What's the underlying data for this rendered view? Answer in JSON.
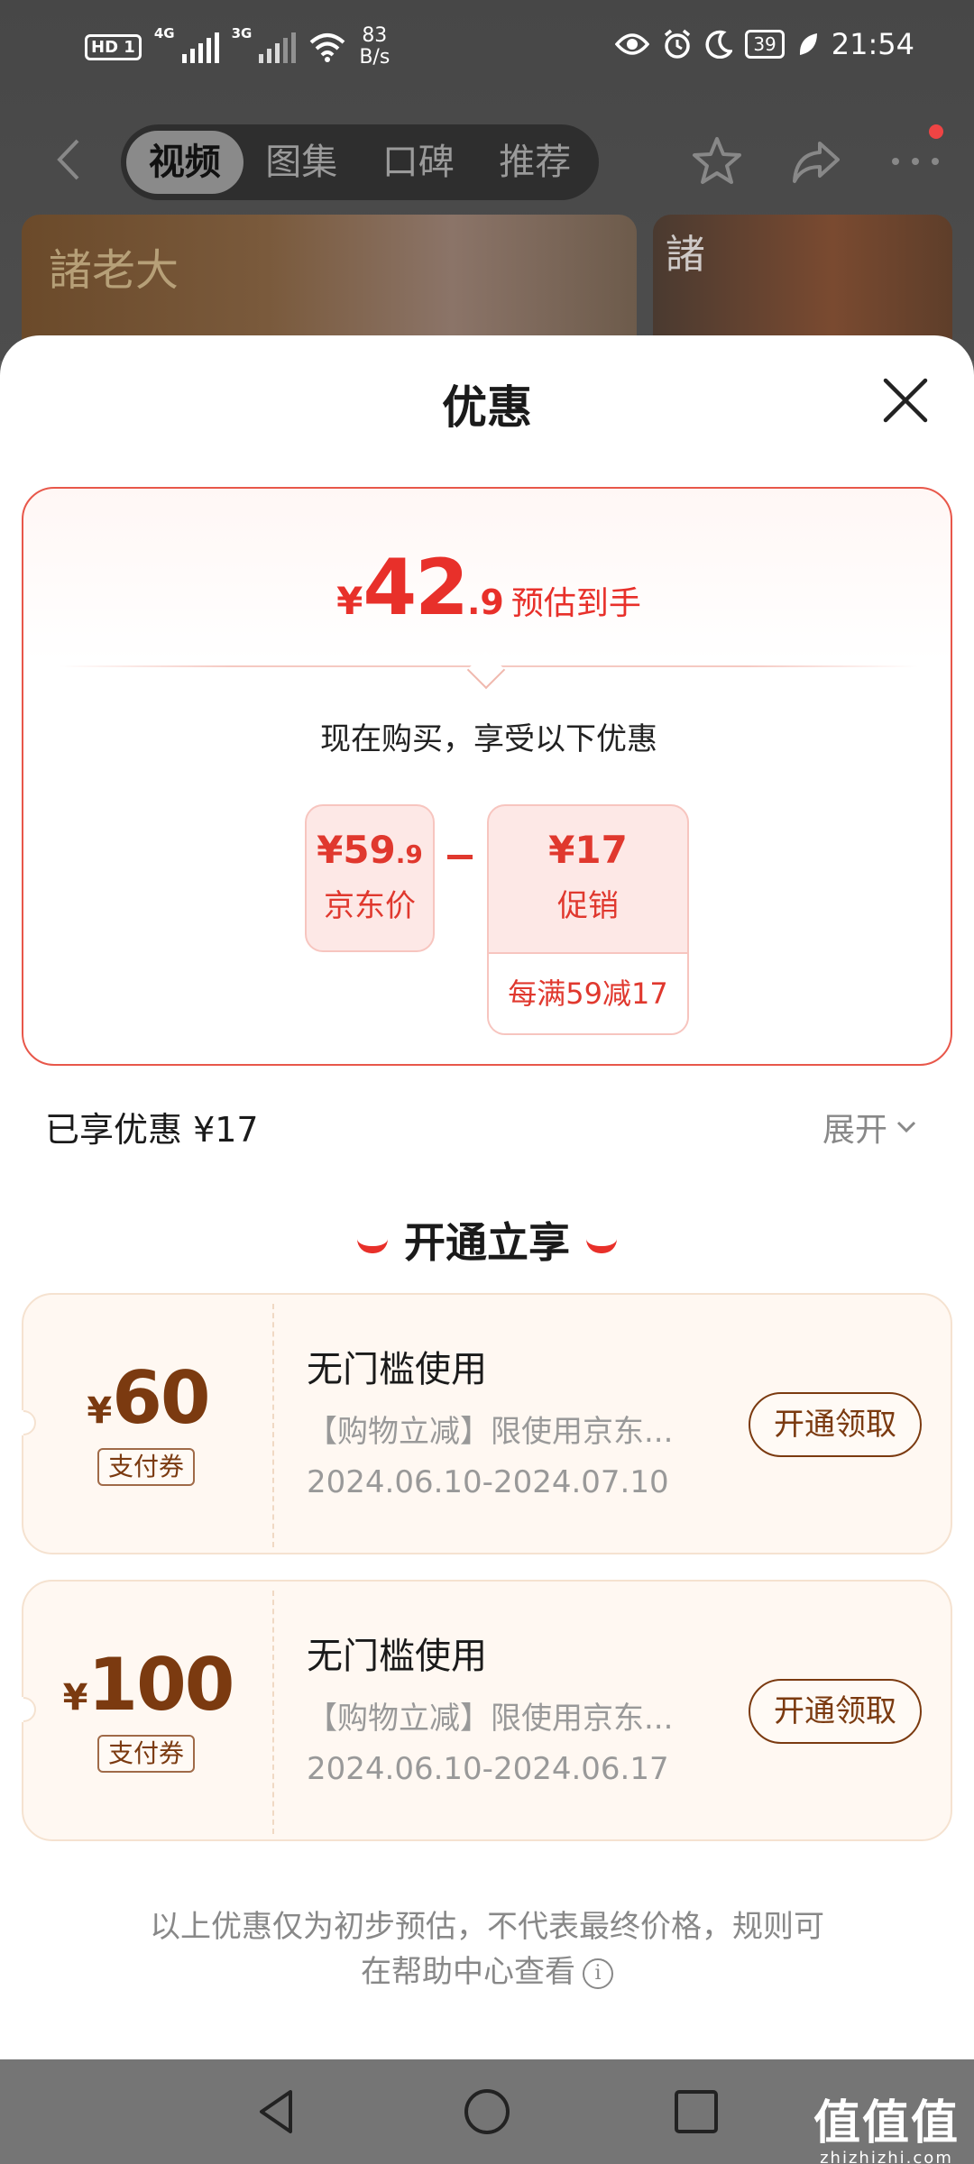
{
  "status_bar": {
    "hd": "HD",
    "sim1": "1",
    "net1": "4G",
    "net2": "3G",
    "speed_value": "83",
    "speed_unit": "B/s",
    "battery": "39",
    "time": "21:54"
  },
  "top_nav": {
    "tabs": [
      "视频",
      "图集",
      "口碑",
      "推荐"
    ],
    "active_tab": 0
  },
  "background": {
    "brand_text_left": "諸老大",
    "brand_text_right": "諸"
  },
  "sheet": {
    "title": "优惠",
    "estimate": {
      "currency": "¥",
      "integer": "42",
      "decimal": ".9",
      "label": "预估到手"
    },
    "buy_note": "现在购买，享受以下优惠",
    "jd_price": {
      "currency": "¥",
      "integer": "59",
      "decimal": ".9",
      "label": "京东价"
    },
    "promo": {
      "value": "¥17",
      "label": "促销",
      "rule": "每满59减17"
    },
    "enjoyed": "已享优惠 ¥17",
    "expand": "展开",
    "section_title": "开通立享",
    "coupons": [
      {
        "currency": "¥",
        "amount": "60",
        "type": "支付券",
        "title": "无门槛使用",
        "desc": "【购物立减】限使用京东...",
        "date": "2024.06.10-2024.07.10",
        "button": "开通领取"
      },
      {
        "currency": "¥",
        "amount": "100",
        "type": "支付券",
        "title": "无门槛使用",
        "desc": "【购物立减】限使用京东...",
        "date": "2024.06.10-2024.06.17",
        "button": "开通领取"
      }
    ],
    "footnote_line1": "以上优惠仅为初步预估，不代表最终价格，规则可",
    "footnote_line2": "在帮助中心查看"
  },
  "watermark": {
    "glyphs": "值值值",
    "site": "zhizhizhi.com"
  },
  "colors": {
    "accent_red": "#e8302a",
    "coupon_brown": "#7b3a10"
  }
}
